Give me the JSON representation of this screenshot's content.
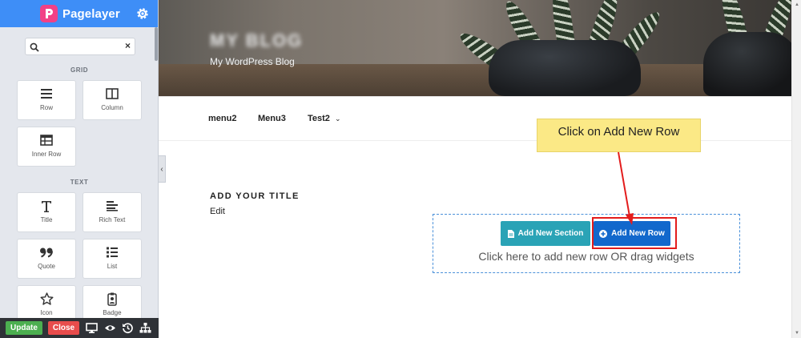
{
  "sidebar": {
    "brand": "Pagelayer",
    "search": {
      "value": "",
      "placeholder": ""
    },
    "sections": [
      {
        "title": "GRID",
        "widgets": [
          "Row",
          "Column",
          "Inner Row"
        ]
      },
      {
        "title": "TEXT",
        "widgets": [
          "Title",
          "Rich Text",
          "Quote",
          "List",
          "Icon",
          "Badge"
        ]
      }
    ],
    "footer": {
      "update_label": "Update",
      "close_label": "Close"
    }
  },
  "site": {
    "title": "MY BLOG",
    "tagline": "My WordPress Blog",
    "menu": [
      "menu2",
      "Menu3",
      "Test2"
    ]
  },
  "content": {
    "title_placeholder": "ADD YOUR TITLE",
    "edit_link": "Edit",
    "add_section_label": "Add New Section",
    "add_row_label": "Add New Row",
    "drop_hint": "Click here to add new row OR drag widgets"
  },
  "annotation": {
    "callout_text": "Click on Add New Row",
    "highlight_color": "#e31c1c",
    "callout_color": "#fbe986"
  },
  "colors": {
    "sidebar_header": "#3e8ef7",
    "update_button": "#4caf50",
    "close_button": "#e84c4c",
    "section_button": "#2aa3b6",
    "row_button": "#1268cc"
  }
}
